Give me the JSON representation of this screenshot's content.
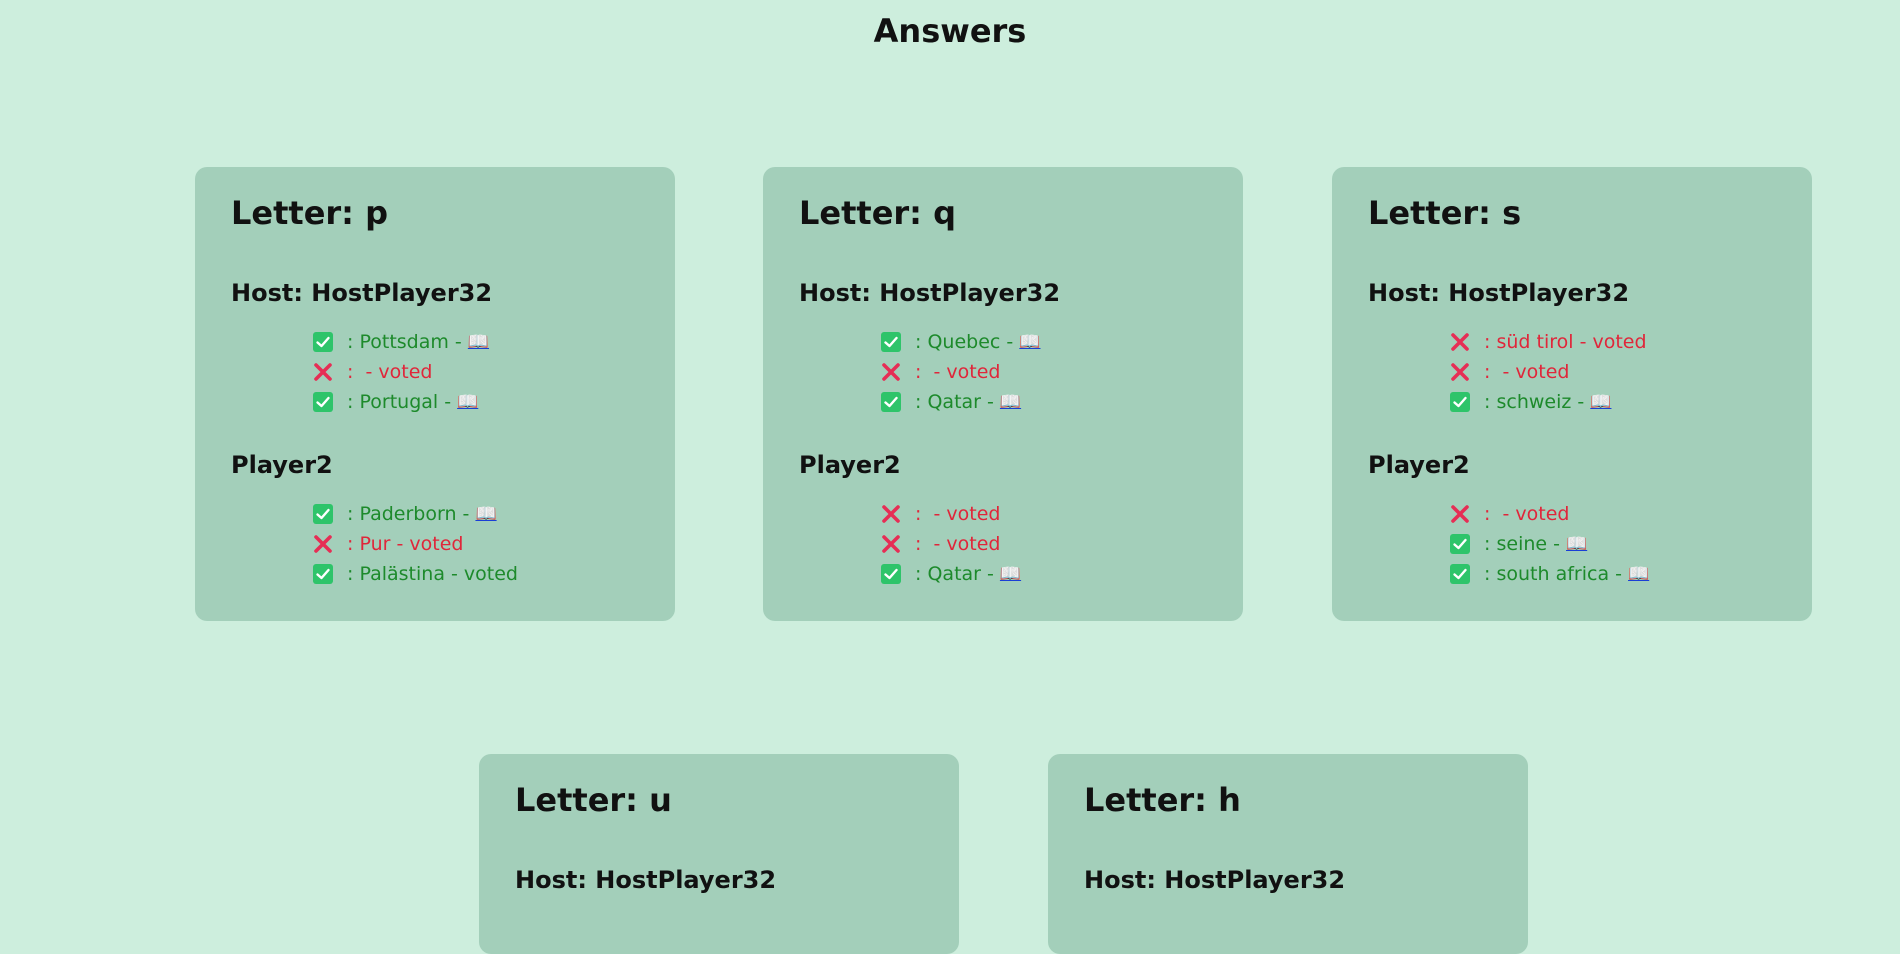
{
  "page": {
    "title": "Answers"
  },
  "colors": {
    "background": "#cdeedd",
    "card": "#a3cfba",
    "correct": "#1d8a2b",
    "wrong": "#e0263a",
    "link": "#1a3fd6"
  },
  "cards": [
    {
      "title": "Letter: p",
      "players": [
        {
          "name": "Host: HostPlayer32",
          "answers": [
            {
              "status": "correct",
              "text": " : Pottsdam - ",
              "link": "📖"
            },
            {
              "status": "wrong",
              "text": " :  - voted",
              "link": ""
            },
            {
              "status": "correct",
              "text": " : Portugal - ",
              "link": "📖"
            }
          ]
        },
        {
          "name": "Player2",
          "answers": [
            {
              "status": "correct",
              "text": " : Paderborn - ",
              "link": "📖"
            },
            {
              "status": "wrong",
              "text": " : Pur - voted",
              "link": ""
            },
            {
              "status": "correct",
              "text": " : Palästina - voted",
              "link": ""
            }
          ]
        }
      ]
    },
    {
      "title": "Letter: q",
      "players": [
        {
          "name": "Host: HostPlayer32",
          "answers": [
            {
              "status": "correct",
              "text": " : Quebec - ",
              "link": "📖"
            },
            {
              "status": "wrong",
              "text": " :  - voted",
              "link": ""
            },
            {
              "status": "correct",
              "text": " : Qatar - ",
              "link": "📖"
            }
          ]
        },
        {
          "name": "Player2",
          "answers": [
            {
              "status": "wrong",
              "text": " :  - voted",
              "link": ""
            },
            {
              "status": "wrong",
              "text": " :  - voted",
              "link": ""
            },
            {
              "status": "correct",
              "text": " : Qatar - ",
              "link": "📖"
            }
          ]
        }
      ]
    },
    {
      "title": "Letter: s",
      "players": [
        {
          "name": "Host: HostPlayer32",
          "answers": [
            {
              "status": "wrong",
              "text": " : süd tirol - voted",
              "link": ""
            },
            {
              "status": "wrong",
              "text": " :  - voted",
              "link": ""
            },
            {
              "status": "correct",
              "text": " : schweiz - ",
              "link": "📖"
            }
          ]
        },
        {
          "name": "Player2",
          "answers": [
            {
              "status": "wrong",
              "text": " :  - voted",
              "link": ""
            },
            {
              "status": "correct",
              "text": " : seine - ",
              "link": "📖"
            },
            {
              "status": "correct",
              "text": " : south africa - ",
              "link": "📖"
            }
          ]
        }
      ]
    },
    {
      "title": "Letter: u",
      "players": [
        {
          "name": "Host: HostPlayer32",
          "answers": []
        }
      ]
    },
    {
      "title": "Letter: h",
      "players": [
        {
          "name": "Host: HostPlayer32",
          "answers": []
        }
      ]
    }
  ]
}
